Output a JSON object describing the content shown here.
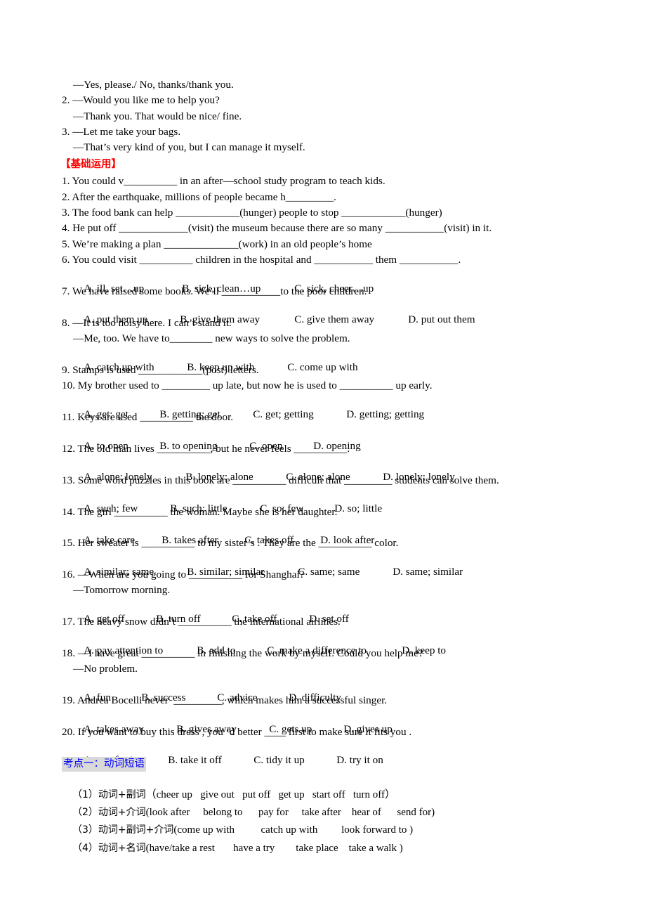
{
  "dialogue": {
    "l0": "—Yes, please./ No, thanks/thank you.",
    "l1": "2. —Would you like me to help you?",
    "l2": "—Thank you. That would be nice/ fine.",
    "l3": "3. —Let me take your bags.",
    "l4": "—That’s very kind of you, but I can manage it myself."
  },
  "section_heading": "【基础运用】",
  "questions": [
    {
      "stem": "1. You could v__________ in an after—school study program to teach kids."
    },
    {
      "stem": "2. After the earthquake, millions of people became h_________."
    },
    {
      "stem": "3. The food bank can help ____________(hunger) people to stop ____________(hunger)"
    },
    {
      "stem": "4. He put off _____________(visit) the museum because there are so many ___________(visit) in it."
    },
    {
      "stem": "5. We’re making a plan ______________(work) in an old people’s home"
    },
    {
      "stem": "6. You could visit __________ children in the hospital and ___________ them ___________.",
      "options": [
        "A. ill, set…up",
        "B. sick, clean…up",
        "C. sick, cheer…up"
      ]
    },
    {
      "stem": "7. We have raised some books. We’ll ___________to the poor children.",
      "options": [
        "A. put them up",
        "B. give them away",
        "C. give them away",
        "D. put out them"
      ]
    },
    {
      "stem": "8. —It is too noisy here. I can’t stand it.",
      "reply": "—Me, too. We have to________ new ways to solve the problem.",
      "options": [
        "A. catch up with",
        "B. keep up with",
        "C. come up with"
      ]
    },
    {
      "stem": "9. Stamps is used ____________(post) letters."
    },
    {
      "stem": "10. My brother used to _________ up late, but now he is used to __________ up early.",
      "options": [
        "A. get; get",
        "B. getting; get",
        "C. get; getting",
        "D. getting; getting"
      ]
    },
    {
      "stem": "11. Keys are used __________ the door.",
      "options": [
        "A. to open",
        "B. to opening",
        "C. open",
        "D. opening"
      ]
    },
    {
      "stem": "12. The old man lives __________, but he never feels __________.",
      "options": [
        "A. alone; lonely",
        "B. lonely; alone",
        "C. alone; alone",
        "D. lonely; lonely"
      ]
    },
    {
      "stem": "13. Some word puzzles in this book are __________ difficult that _________ students can solve them.",
      "options": [
        "A. such; few",
        "B. such; little",
        "C. so; few",
        "D. so; little"
      ]
    },
    {
      "stem": "14. The girl __________ the woman. Maybe she is her daughter.",
      "options": [
        "A. take care",
        "B. takes after",
        "C. takes off",
        "D. look after"
      ]
    },
    {
      "stem": "15. Her sweater is __________ to my sister’s . They are the __________ color.",
      "options": [
        "A. similar; same",
        "B. similar; similar",
        "C. same; same",
        "D. same; similar"
      ]
    },
    {
      "stem": "16. —When are you going to __________ for Shanghai?",
      "reply": "—Tomorrow morning.",
      "options": [
        "A. get off",
        "B. turn off",
        "C. take off",
        "D. set off"
      ]
    },
    {
      "stem": "17. The heavy snow didn’t __________ the international airlines.",
      "options": [
        "A. pay attention to",
        "B. add to",
        "C. make a difference to",
        "D. keep to"
      ]
    },
    {
      "stem": "18. —I have great __________ in finishing the work by myself. Could you help me?",
      "reply": "—No problem.",
      "options": [
        "A. fun",
        "B. success",
        "C. advice",
        "D. difficulty"
      ]
    },
    {
      "stem": "19. Andrea Bocelli never  _________, which makes him a successful singer.",
      "options": [
        "A. takes away",
        "B. gives away",
        "C. gets up",
        "D. gives up"
      ]
    },
    {
      "stem": "20. If you want to buy this dress , you ‘d better ____ first to make sure it fits you .",
      "options": [
        "A. pay for it",
        "B. take it off",
        "C. tidy it up",
        "D. try it on"
      ]
    }
  ],
  "key_point": {
    "heading": "考点一：动词短语",
    "categories": [
      {
        "label": "（1）动词+副词",
        "text": "（cheer up   give out   put off   get up   start off   turn off）"
      },
      {
        "label": "（2）动词+介词",
        "text": "(look after     belong to      pay for     take after    hear of      send for)"
      },
      {
        "label": "（3）动词+副词+介词",
        "text": "(come up with          catch up with         look forward to )"
      },
      {
        "label": "（4）动词+名词",
        "text": "(have/take a rest       have a try        take place    take a walk )"
      }
    ]
  },
  "colors": {
    "section_heading": "#ff0000",
    "key_point_heading": "#0000ff",
    "key_point_highlight": "#d9d9d9"
  }
}
